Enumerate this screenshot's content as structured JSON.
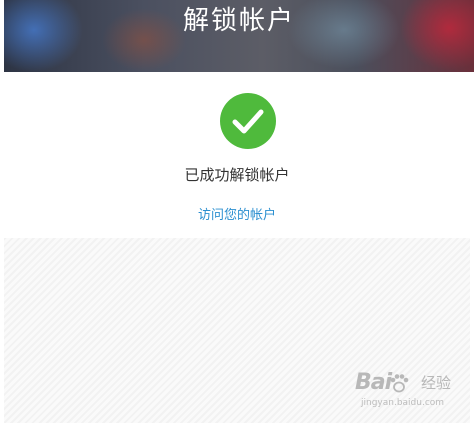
{
  "header": {
    "title": "解锁帐户"
  },
  "status": {
    "icon": "check-icon",
    "message": "已成功解锁帐户",
    "success_color": "#4fba3c"
  },
  "actions": {
    "visit_account_link": "访问您的帐户",
    "link_color": "#2b8fd0"
  },
  "watermark": {
    "logo_text": "Bai",
    "logo_suffix": "经验",
    "url": "jingyan.baidu.com"
  }
}
